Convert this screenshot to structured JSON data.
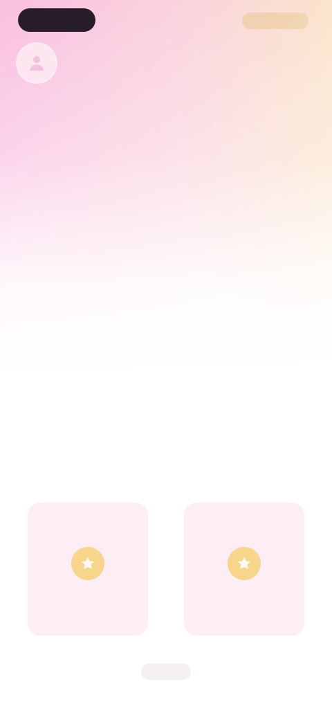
{
  "header": {
    "left_pill_label": "",
    "right_pill_label": "",
    "avatar_icon": "user-icon"
  },
  "main": {
    "title": ""
  },
  "cards": [
    {
      "label": "",
      "icon": "star-icon",
      "icon_color": "#f7d58a"
    },
    {
      "label": "",
      "icon": "star-icon",
      "icon_color": "#f7d58a"
    }
  ],
  "footer": {
    "link_label": ""
  },
  "colors": {
    "gradient_left": "#f9bfe0",
    "gradient_right": "#fbe4cc",
    "title": "#6b4a86",
    "card_bg": "#fdeef6",
    "card_label": "#a18bb0",
    "dark_pill": "#2a1d2a"
  }
}
